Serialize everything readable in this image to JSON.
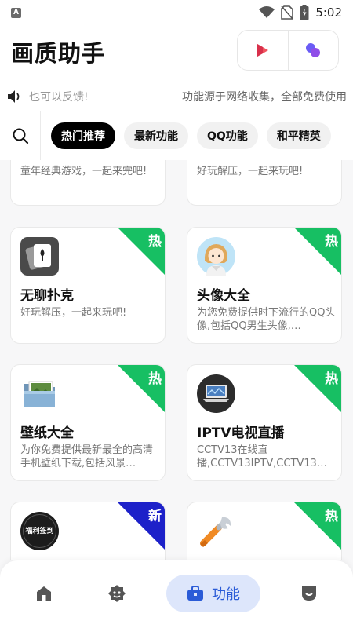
{
  "status_bar": {
    "time": "5:02",
    "app_icon_letter": "A"
  },
  "header": {
    "title": "画质助手"
  },
  "notice": {
    "left_text": "也可以反馈!",
    "right_text": "功能源于网络收集，全部免费使用"
  },
  "tabs": [
    {
      "label": "热门推荐",
      "active": true
    },
    {
      "label": "最新功能",
      "active": false
    },
    {
      "label": "QQ功能",
      "active": false
    },
    {
      "label": "和平精英",
      "active": false
    }
  ],
  "cards_partial_top": [
    {
      "desc": "童年经典游戏，一起来完吧!"
    },
    {
      "desc": "好玩解压，一起来玩吧!"
    }
  ],
  "cards": [
    {
      "title": "无聊扑克",
      "desc": "好玩解压，一起来玩吧!",
      "badge": "热",
      "icon": "poker-cards-icon"
    },
    {
      "title": "头像大全",
      "desc": "为您免费提供时下流行的QQ头像,包括QQ男生头像,…",
      "badge": "热",
      "icon": "avatar-girl-icon"
    },
    {
      "title": "壁纸大全",
      "desc": "为你免费提供最新最全的高清手机壁纸下载,包括风景…",
      "badge": "热",
      "icon": "wallpaper-folder-icon"
    },
    {
      "title": "IPTV电视直播",
      "desc": "CCTV13在线直播,CCTV13IPTV,CCTV13…",
      "badge": "热",
      "icon": "laptop-tv-icon"
    }
  ],
  "cards_bottom": [
    {
      "badge": "新",
      "icon": "welfare-checkin-icon",
      "icon_text": "福利签到"
    },
    {
      "badge": "热",
      "icon": "wrench-icon"
    }
  ],
  "bottom_nav": {
    "items": [
      {
        "icon": "home-icon"
      },
      {
        "icon": "discover-icon"
      },
      {
        "icon": "briefcase-icon",
        "label": "功能",
        "active": true
      },
      {
        "icon": "profile-icon"
      }
    ]
  },
  "colors": {
    "hot_badge": "#17bf63",
    "new_badge": "#1d21c9",
    "nav_active": "#2a5bd7",
    "nav_active_bg": "#dde6fb"
  }
}
